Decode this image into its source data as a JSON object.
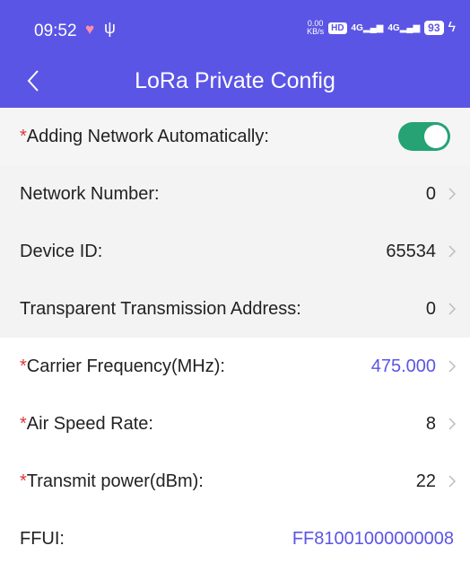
{
  "status_bar": {
    "time": "09:52",
    "speed_value": "0.00",
    "speed_unit": "KB/s",
    "hd_label": "HD",
    "sim1_label": "4G",
    "sim2_label": "4G",
    "battery": "93"
  },
  "header": {
    "title": "LoRa Private Config"
  },
  "settings": [
    {
      "required": true,
      "label": "Adding Network Automatically:",
      "toggle_on": true
    },
    {
      "required": false,
      "label": "Network Number:",
      "value": "0"
    },
    {
      "required": false,
      "label": "Device ID:",
      "value": "65534"
    },
    {
      "required": false,
      "label": "Transparent Transmission Address:",
      "value": "0"
    },
    {
      "required": true,
      "label": "Carrier Frequency(MHz):",
      "value": "475.000"
    },
    {
      "required": true,
      "label": "Air Speed Rate:",
      "value": "8"
    },
    {
      "required": true,
      "label": "Transmit power(dBm):",
      "value": "22"
    },
    {
      "required": false,
      "label": "FFUI:",
      "value": "FF81001000000008"
    }
  ],
  "colors": {
    "header_bg": "#5b55e6",
    "accent": "#5b55e6",
    "required_star": "#e03535",
    "toggle_on": "#25a375"
  }
}
